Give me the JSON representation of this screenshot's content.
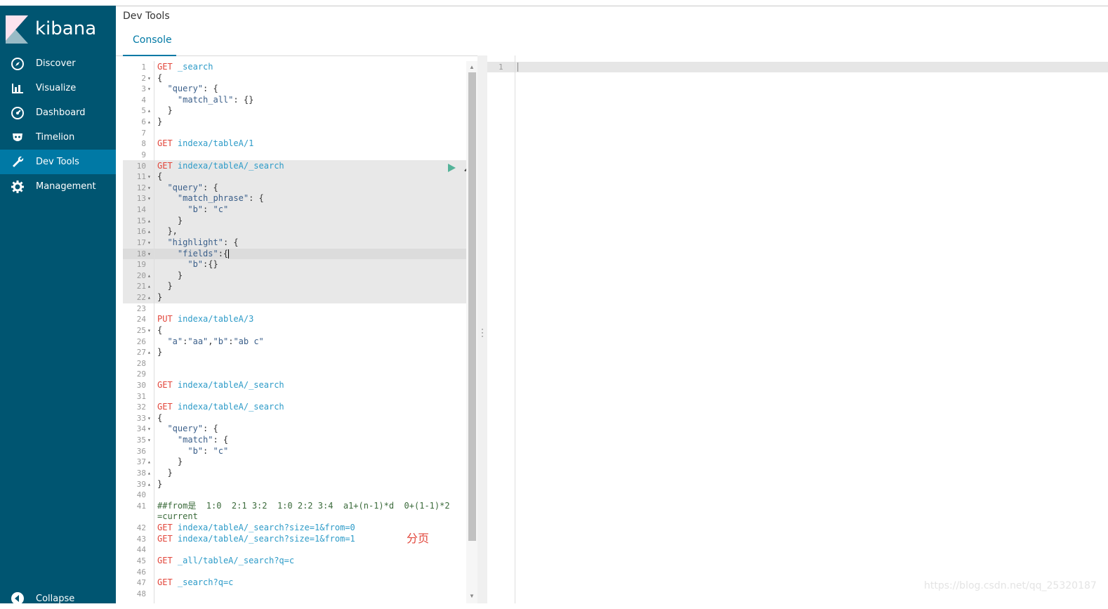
{
  "app": {
    "logo_text": "kibana"
  },
  "sidebar": {
    "items": [
      {
        "label": "Discover",
        "icon": "compass-icon",
        "active": false
      },
      {
        "label": "Visualize",
        "icon": "bar-chart-icon",
        "active": false
      },
      {
        "label": "Dashboard",
        "icon": "dashboard-icon",
        "active": false
      },
      {
        "label": "Timelion",
        "icon": "timelion-icon",
        "active": false
      },
      {
        "label": "Dev Tools",
        "icon": "wrench-icon",
        "active": true
      },
      {
        "label": "Management",
        "icon": "gear-icon",
        "active": false
      }
    ],
    "collapse_label": "Collapse"
  },
  "header": {
    "title": "Dev Tools",
    "tabs": [
      {
        "label": "Console",
        "active": true
      }
    ]
  },
  "editor": {
    "lines": [
      {
        "n": "1",
        "fold": "",
        "parts": [
          [
            "kw",
            "GET"
          ],
          [
            "plain",
            " "
          ],
          [
            "url",
            "_search"
          ]
        ]
      },
      {
        "n": "2",
        "fold": "▾",
        "parts": [
          [
            "plain",
            "{"
          ]
        ]
      },
      {
        "n": "3",
        "fold": "▾",
        "parts": [
          [
            "plain",
            "  "
          ],
          [
            "str",
            "\"query\""
          ],
          [
            "plain",
            ": {"
          ]
        ]
      },
      {
        "n": "4",
        "fold": "",
        "parts": [
          [
            "plain",
            "    "
          ],
          [
            "str",
            "\"match_all\""
          ],
          [
            "plain",
            ": {}"
          ]
        ]
      },
      {
        "n": "5",
        "fold": "▴",
        "parts": [
          [
            "plain",
            "  }"
          ]
        ]
      },
      {
        "n": "6",
        "fold": "▴",
        "parts": [
          [
            "plain",
            "}"
          ]
        ]
      },
      {
        "n": "7",
        "fold": "",
        "parts": []
      },
      {
        "n": "8",
        "fold": "",
        "parts": [
          [
            "kw",
            "GET"
          ],
          [
            "plain",
            " "
          ],
          [
            "url",
            "indexa/tableA/1"
          ]
        ]
      },
      {
        "n": "9",
        "fold": "",
        "parts": []
      },
      {
        "n": "10",
        "fold": "",
        "parts": [
          [
            "kw",
            "GET"
          ],
          [
            "plain",
            " "
          ],
          [
            "url",
            "indexa/tableA/_search"
          ]
        ]
      },
      {
        "n": "11",
        "fold": "▾",
        "parts": [
          [
            "plain",
            "{"
          ]
        ]
      },
      {
        "n": "12",
        "fold": "▾",
        "parts": [
          [
            "plain",
            "  "
          ],
          [
            "str",
            "\"query\""
          ],
          [
            "plain",
            ": {"
          ]
        ]
      },
      {
        "n": "13",
        "fold": "▾",
        "parts": [
          [
            "plain",
            "    "
          ],
          [
            "str",
            "\"match_phrase\""
          ],
          [
            "plain",
            ": {"
          ]
        ]
      },
      {
        "n": "14",
        "fold": "",
        "parts": [
          [
            "plain",
            "      "
          ],
          [
            "str",
            "\"b\""
          ],
          [
            "plain",
            ": "
          ],
          [
            "str",
            "\"c\""
          ]
        ]
      },
      {
        "n": "15",
        "fold": "▴",
        "parts": [
          [
            "plain",
            "    }"
          ]
        ]
      },
      {
        "n": "16",
        "fold": "▴",
        "parts": [
          [
            "plain",
            "  },"
          ]
        ]
      },
      {
        "n": "17",
        "fold": "▾",
        "parts": [
          [
            "plain",
            "  "
          ],
          [
            "str",
            "\"highlight\""
          ],
          [
            "plain",
            ": {"
          ]
        ]
      },
      {
        "n": "18",
        "fold": "▾",
        "parts": [
          [
            "plain",
            "    "
          ],
          [
            "str",
            "\"fields\""
          ],
          [
            "plain",
            ":{"
          ]
        ],
        "cursor": true
      },
      {
        "n": "19",
        "fold": "",
        "parts": [
          [
            "plain",
            "      "
          ],
          [
            "str",
            "\"b\""
          ],
          [
            "plain",
            ":{}"
          ]
        ]
      },
      {
        "n": "20",
        "fold": "▴",
        "parts": [
          [
            "plain",
            "    }"
          ]
        ]
      },
      {
        "n": "21",
        "fold": "▴",
        "parts": [
          [
            "plain",
            "  }"
          ]
        ]
      },
      {
        "n": "22",
        "fold": "▴",
        "parts": [
          [
            "plain",
            "}"
          ]
        ]
      },
      {
        "n": "23",
        "fold": "",
        "parts": []
      },
      {
        "n": "24",
        "fold": "",
        "parts": [
          [
            "kw",
            "PUT"
          ],
          [
            "plain",
            " "
          ],
          [
            "url",
            "indexa/tableA/3"
          ]
        ]
      },
      {
        "n": "25",
        "fold": "▾",
        "parts": [
          [
            "plain",
            "{"
          ]
        ]
      },
      {
        "n": "26",
        "fold": "",
        "parts": [
          [
            "plain",
            "  "
          ],
          [
            "str",
            "\"a\""
          ],
          [
            "plain",
            ":"
          ],
          [
            "str",
            "\"aa\""
          ],
          [
            "plain",
            ","
          ],
          [
            "str",
            "\"b\""
          ],
          [
            "plain",
            ":"
          ],
          [
            "str",
            "\"ab c\""
          ]
        ]
      },
      {
        "n": "27",
        "fold": "▴",
        "parts": [
          [
            "plain",
            "}"
          ]
        ]
      },
      {
        "n": "28",
        "fold": "",
        "parts": []
      },
      {
        "n": "29",
        "fold": "",
        "parts": []
      },
      {
        "n": "30",
        "fold": "",
        "parts": [
          [
            "kw",
            "GET"
          ],
          [
            "plain",
            " "
          ],
          [
            "url",
            "indexa/tableA/_search"
          ]
        ]
      },
      {
        "n": "31",
        "fold": "",
        "parts": []
      },
      {
        "n": "32",
        "fold": "",
        "parts": [
          [
            "kw",
            "GET"
          ],
          [
            "plain",
            " "
          ],
          [
            "url",
            "indexa/tableA/_search"
          ]
        ]
      },
      {
        "n": "33",
        "fold": "▾",
        "parts": [
          [
            "plain",
            "{"
          ]
        ]
      },
      {
        "n": "34",
        "fold": "▾",
        "parts": [
          [
            "plain",
            "  "
          ],
          [
            "str",
            "\"query\""
          ],
          [
            "plain",
            ": {"
          ]
        ]
      },
      {
        "n": "35",
        "fold": "▾",
        "parts": [
          [
            "plain",
            "    "
          ],
          [
            "str",
            "\"match\""
          ],
          [
            "plain",
            ": {"
          ]
        ]
      },
      {
        "n": "36",
        "fold": "",
        "parts": [
          [
            "plain",
            "      "
          ],
          [
            "str",
            "\"b\""
          ],
          [
            "plain",
            ": "
          ],
          [
            "str",
            "\"c\""
          ]
        ]
      },
      {
        "n": "37",
        "fold": "▴",
        "parts": [
          [
            "plain",
            "    }"
          ]
        ]
      },
      {
        "n": "38",
        "fold": "▴",
        "parts": [
          [
            "plain",
            "  }"
          ]
        ]
      },
      {
        "n": "39",
        "fold": "▴",
        "parts": [
          [
            "plain",
            "}"
          ]
        ]
      },
      {
        "n": "40",
        "fold": "",
        "parts": []
      },
      {
        "n": "41",
        "fold": "",
        "parts": [
          [
            "cmt",
            "##from是  1:0  2:1 3:2  1:0 2:2 3:4  a1+(n-1)*d  0+(1-1)*2"
          ]
        ]
      },
      {
        "n": "",
        "fold": "",
        "parts": [
          [
            "cmt",
            "=current"
          ]
        ]
      },
      {
        "n": "42",
        "fold": "",
        "parts": [
          [
            "kw",
            "GET"
          ],
          [
            "plain",
            " "
          ],
          [
            "url",
            "indexa/tableA/_search?size=1&from=0"
          ]
        ]
      },
      {
        "n": "43",
        "fold": "",
        "parts": [
          [
            "kw",
            "GET"
          ],
          [
            "plain",
            " "
          ],
          [
            "url",
            "indexa/tableA/_search?size=1&from=1"
          ]
        ]
      },
      {
        "n": "44",
        "fold": "",
        "parts": []
      },
      {
        "n": "45",
        "fold": "",
        "parts": [
          [
            "kw",
            "GET"
          ],
          [
            "plain",
            " "
          ],
          [
            "url",
            "_all/tableA/_search?q=c"
          ]
        ]
      },
      {
        "n": "46",
        "fold": "",
        "parts": []
      },
      {
        "n": "47",
        "fold": "",
        "parts": [
          [
            "kw",
            "GET"
          ],
          [
            "plain",
            " "
          ],
          [
            "url",
            "_search?q=c"
          ]
        ]
      },
      {
        "n": "48",
        "fold": "",
        "parts": []
      }
    ],
    "annotation": "分页"
  },
  "output": {
    "line_number": "1"
  },
  "watermark": "https://blog.csdn.net/qq_25320187",
  "colors": {
    "sidebar_bg": "#005571",
    "sidebar_active": "#0079a5",
    "keyword": "#e2463b",
    "url": "#2d9bc8",
    "run_green": "#54b399"
  }
}
